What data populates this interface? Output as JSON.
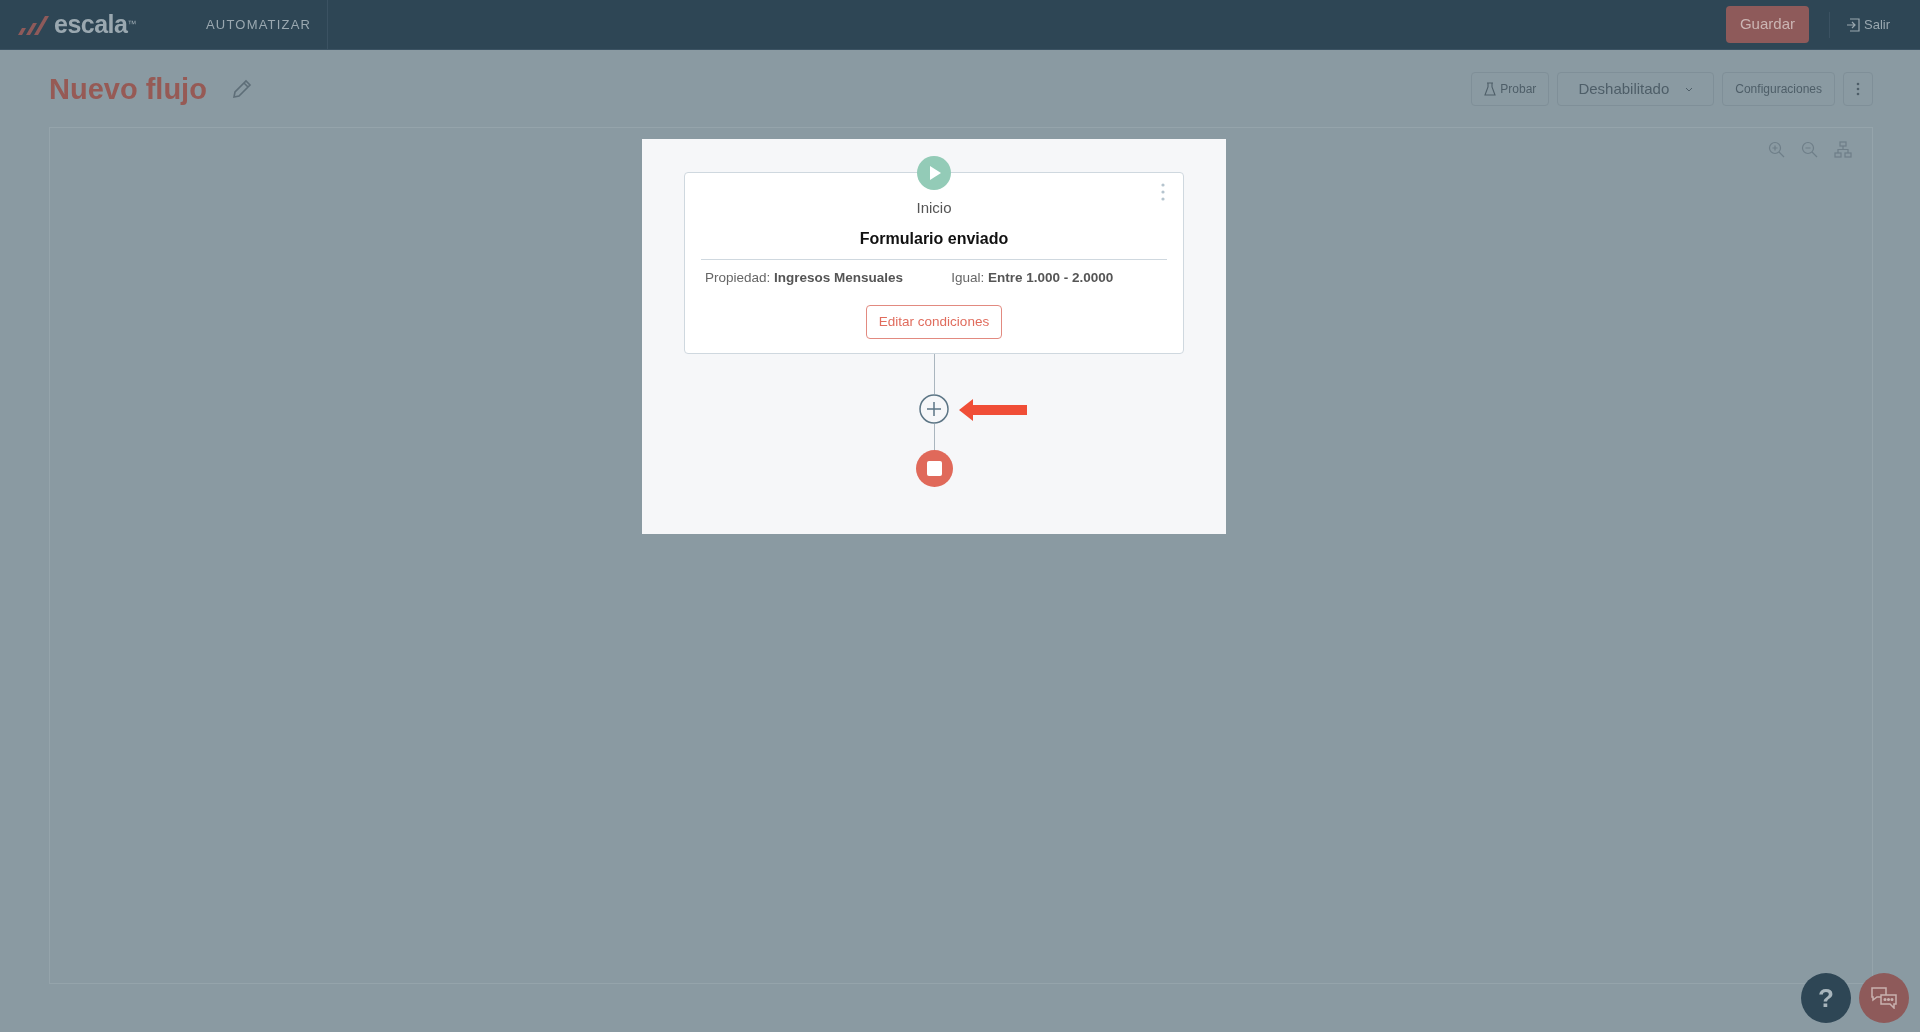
{
  "header": {
    "logo_text": "escala",
    "trademark": "™",
    "nav": "AUTOMATIZAR",
    "save_button": "Guardar",
    "exit_link": "Salir"
  },
  "page": {
    "title": "Nuevo flujo"
  },
  "toolbar": {
    "test_button": "Probar",
    "status_dropdown": "Deshabilitado",
    "settings_button": "Configuraciones"
  },
  "flow": {
    "start_node": {
      "label": "Inicio",
      "title": "Formulario enviado",
      "conditions": [
        {
          "label": "Propiedad:",
          "value": "Ingresos Mensuales"
        },
        {
          "label": "Igual:",
          "value": "Entre 1.000 - 2.0000"
        }
      ],
      "edit_button": "Editar condiciones"
    }
  },
  "help_button": "?"
}
